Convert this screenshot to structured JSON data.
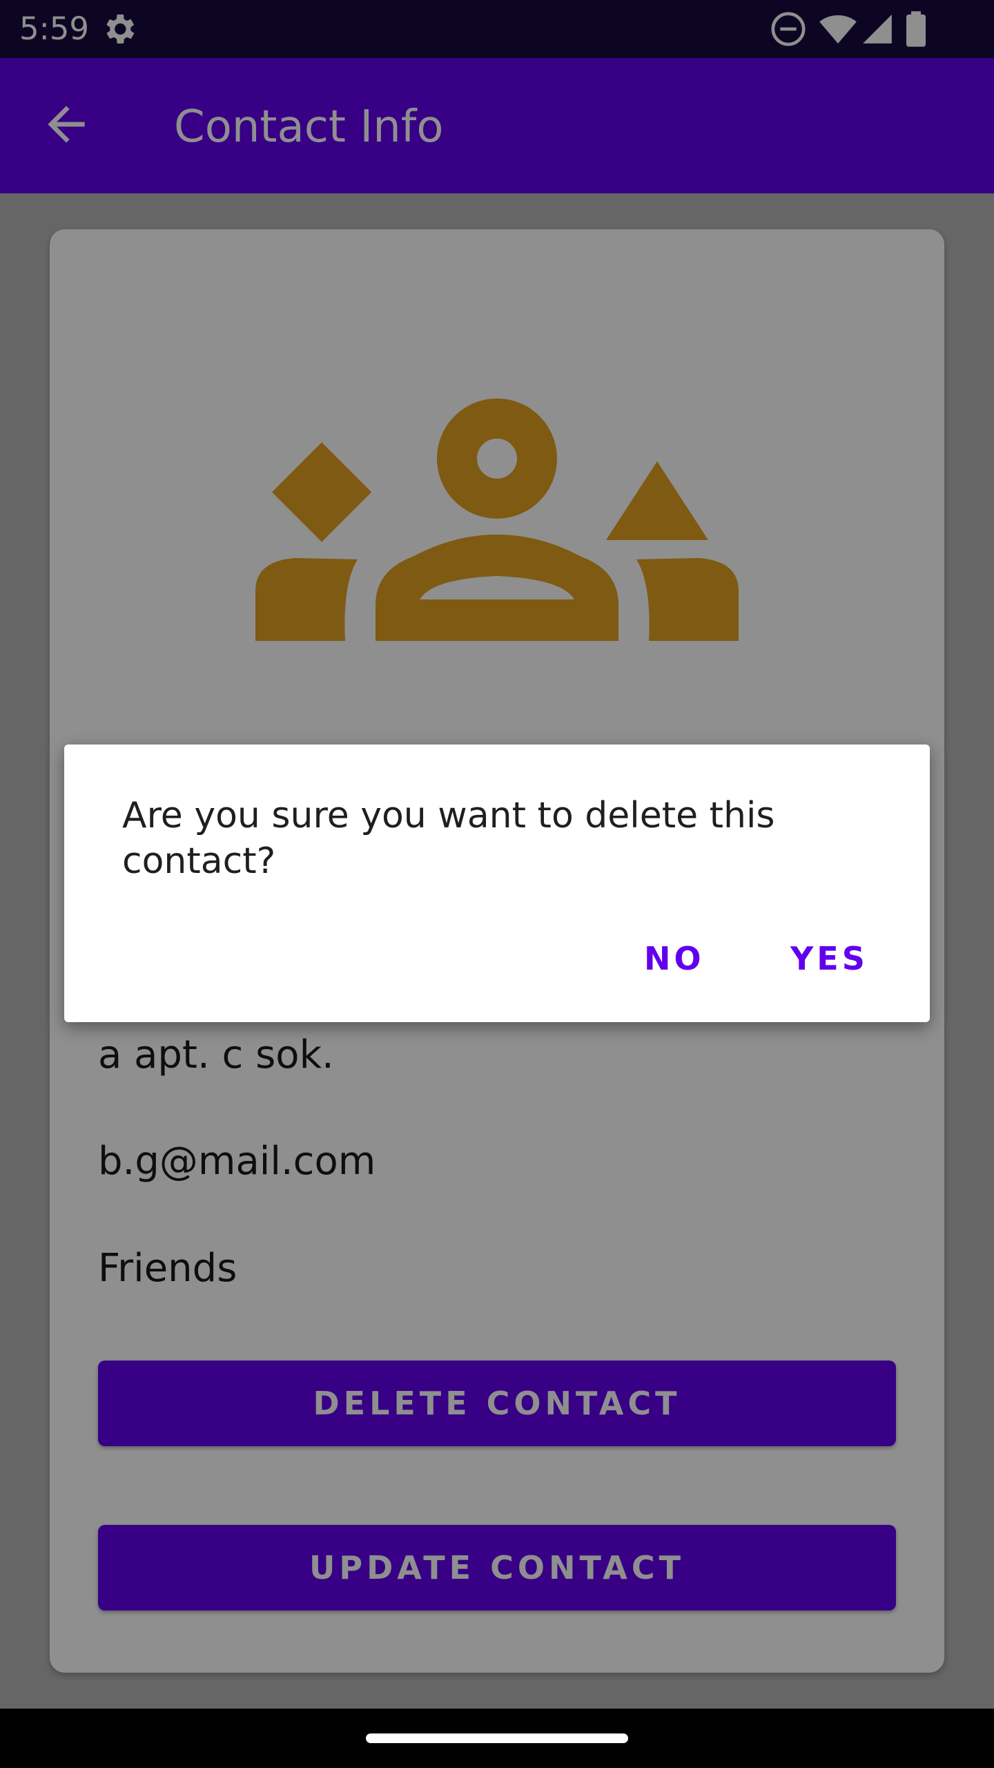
{
  "status_bar": {
    "time": "5:59",
    "icons": [
      "settings-gear-icon",
      "do-not-disturb-icon",
      "wifi-icon",
      "signal-icon",
      "battery-icon"
    ]
  },
  "app_bar": {
    "title": "Contact Info",
    "back_icon": "arrow-back-icon"
  },
  "contact": {
    "avatar_icon": "group-icon",
    "address": "a apt. c sok.",
    "email": "b.g@mail.com",
    "group": "Friends"
  },
  "buttons": {
    "delete": "DELETE CONTACT",
    "update": "UPDATE CONTACT"
  },
  "dialog": {
    "message": "Are you sure you want to delete this contact?",
    "no_label": "NO",
    "yes_label": "YES"
  },
  "colors": {
    "primary": "#6200ee",
    "status_bar": "#180b3f",
    "icon_accent": "#e0a020",
    "scrim_opacity": 0.44
  }
}
